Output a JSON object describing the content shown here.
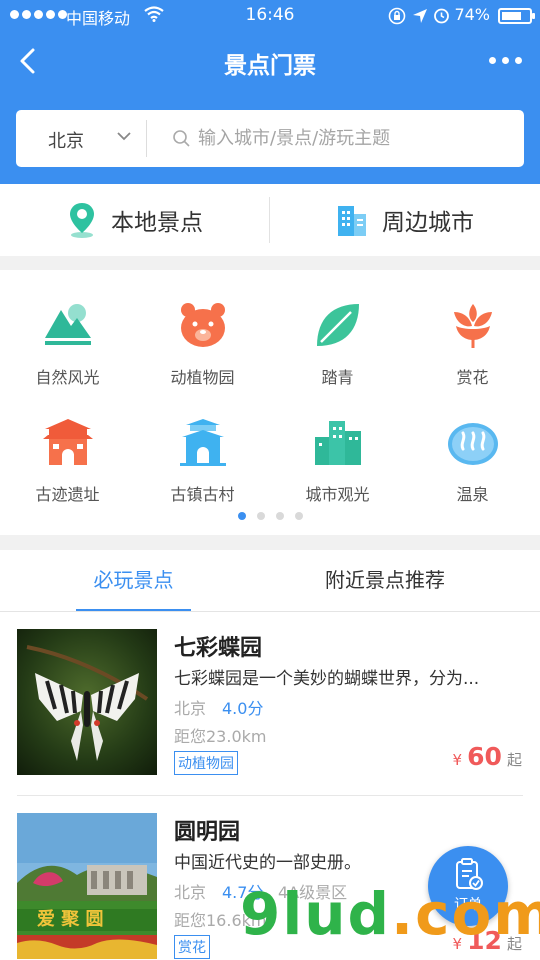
{
  "status_bar": {
    "carrier": "中国移动",
    "time": "16:46",
    "battery": "74%",
    "battery_level": 0.74
  },
  "nav": {
    "title": "景点门票"
  },
  "search": {
    "city": "北京",
    "placeholder": "输入城市/景点/游玩主题"
  },
  "quick": {
    "local_label": "本地景点",
    "nearby_label": "周边城市"
  },
  "categories": [
    {
      "label": "自然风光",
      "icon": "mountain-icon"
    },
    {
      "label": "动植物园",
      "icon": "bear-icon"
    },
    {
      "label": "踏青",
      "icon": "leaf-icon"
    },
    {
      "label": "赏花",
      "icon": "flower-icon"
    },
    {
      "label": "古迹遗址",
      "icon": "gate-tower-icon"
    },
    {
      "label": "古镇古村",
      "icon": "ancient-building-icon"
    },
    {
      "label": "城市观光",
      "icon": "city-buildings-icon"
    },
    {
      "label": "温泉",
      "icon": "hot-spring-icon"
    }
  ],
  "pager": {
    "count": 4,
    "active": 0
  },
  "tabs": {
    "must_play": "必玩景点",
    "nearby_recommend": "附近景点推荐"
  },
  "spots": [
    {
      "name": "七彩蝶园",
      "desc": "七彩蝶园是一个美妙的蝴蝶世界，分为...",
      "city": "北京",
      "score": "4.0分",
      "level": "",
      "distance": "距您23.0km",
      "tag": "动植物园",
      "currency": "¥",
      "price": "60",
      "price_suffix": "起"
    },
    {
      "name": "圆明园",
      "desc": "中国近代史的一部史册。",
      "city": "北京",
      "score": "4.7分",
      "level": "4A级景区",
      "distance": "距您16.6km",
      "tag": "赏花",
      "currency": "¥",
      "price": "12",
      "price_suffix": "起"
    }
  ],
  "order_button": {
    "label": "订单"
  },
  "watermark": {
    "part1": "9lud",
    "part2": ".com"
  },
  "colors": {
    "brand_blue": "#3b8ff0",
    "price_red": "#f05a5a"
  }
}
